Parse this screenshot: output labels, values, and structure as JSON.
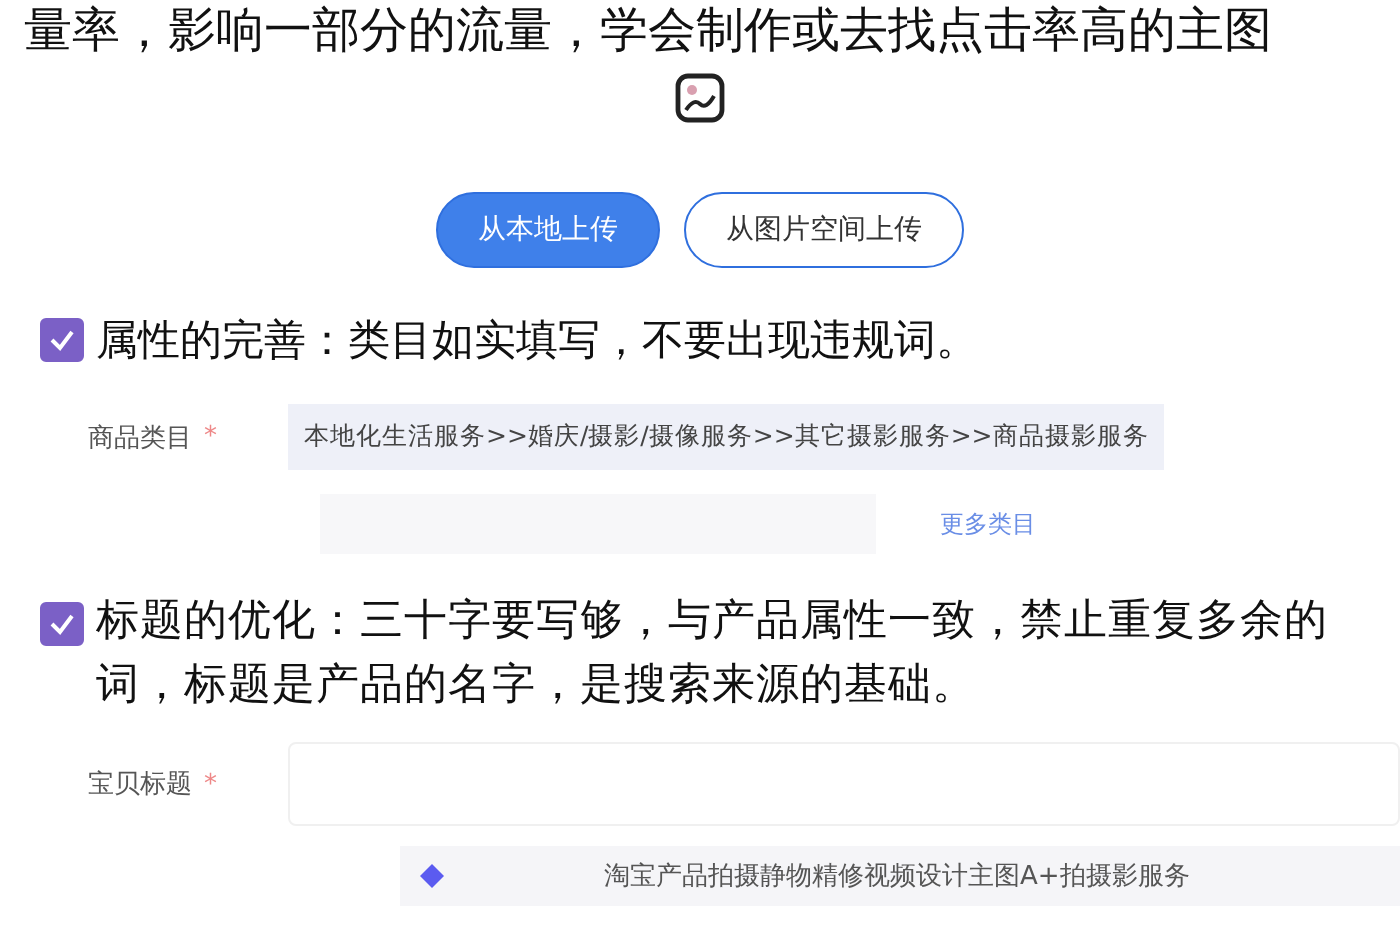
{
  "intro_text": "量率，影响一部分的流量，学会制作或去找点击率高的主图",
  "upload_buttons": [
    {
      "label": "从本地上传",
      "selected": true
    },
    {
      "label": "从图片空间上传",
      "selected": false
    }
  ],
  "point_1": {
    "checked": true,
    "text": "属性的完善：类目如实填写，不要出现违规词。"
  },
  "category_field": {
    "label": "商品类目",
    "required_mark": "*",
    "value": "本地化生活服务>>婚庆/摄影/摄像服务>>其它摄影服务>>商品摄影服务",
    "more_link": "更多类目"
  },
  "point_2": {
    "checked": true,
    "text": "标题的优化：三十字要写够，与产品属性一致，禁止重复多余的词，标题是产品的名字，是搜索来源的基础。"
  },
  "title_field": {
    "label": "宝贝标题",
    "required_mark": "*",
    "suggestion": "淘宝产品拍摄静物精修视频设计主图A+拍摄影服务"
  }
}
